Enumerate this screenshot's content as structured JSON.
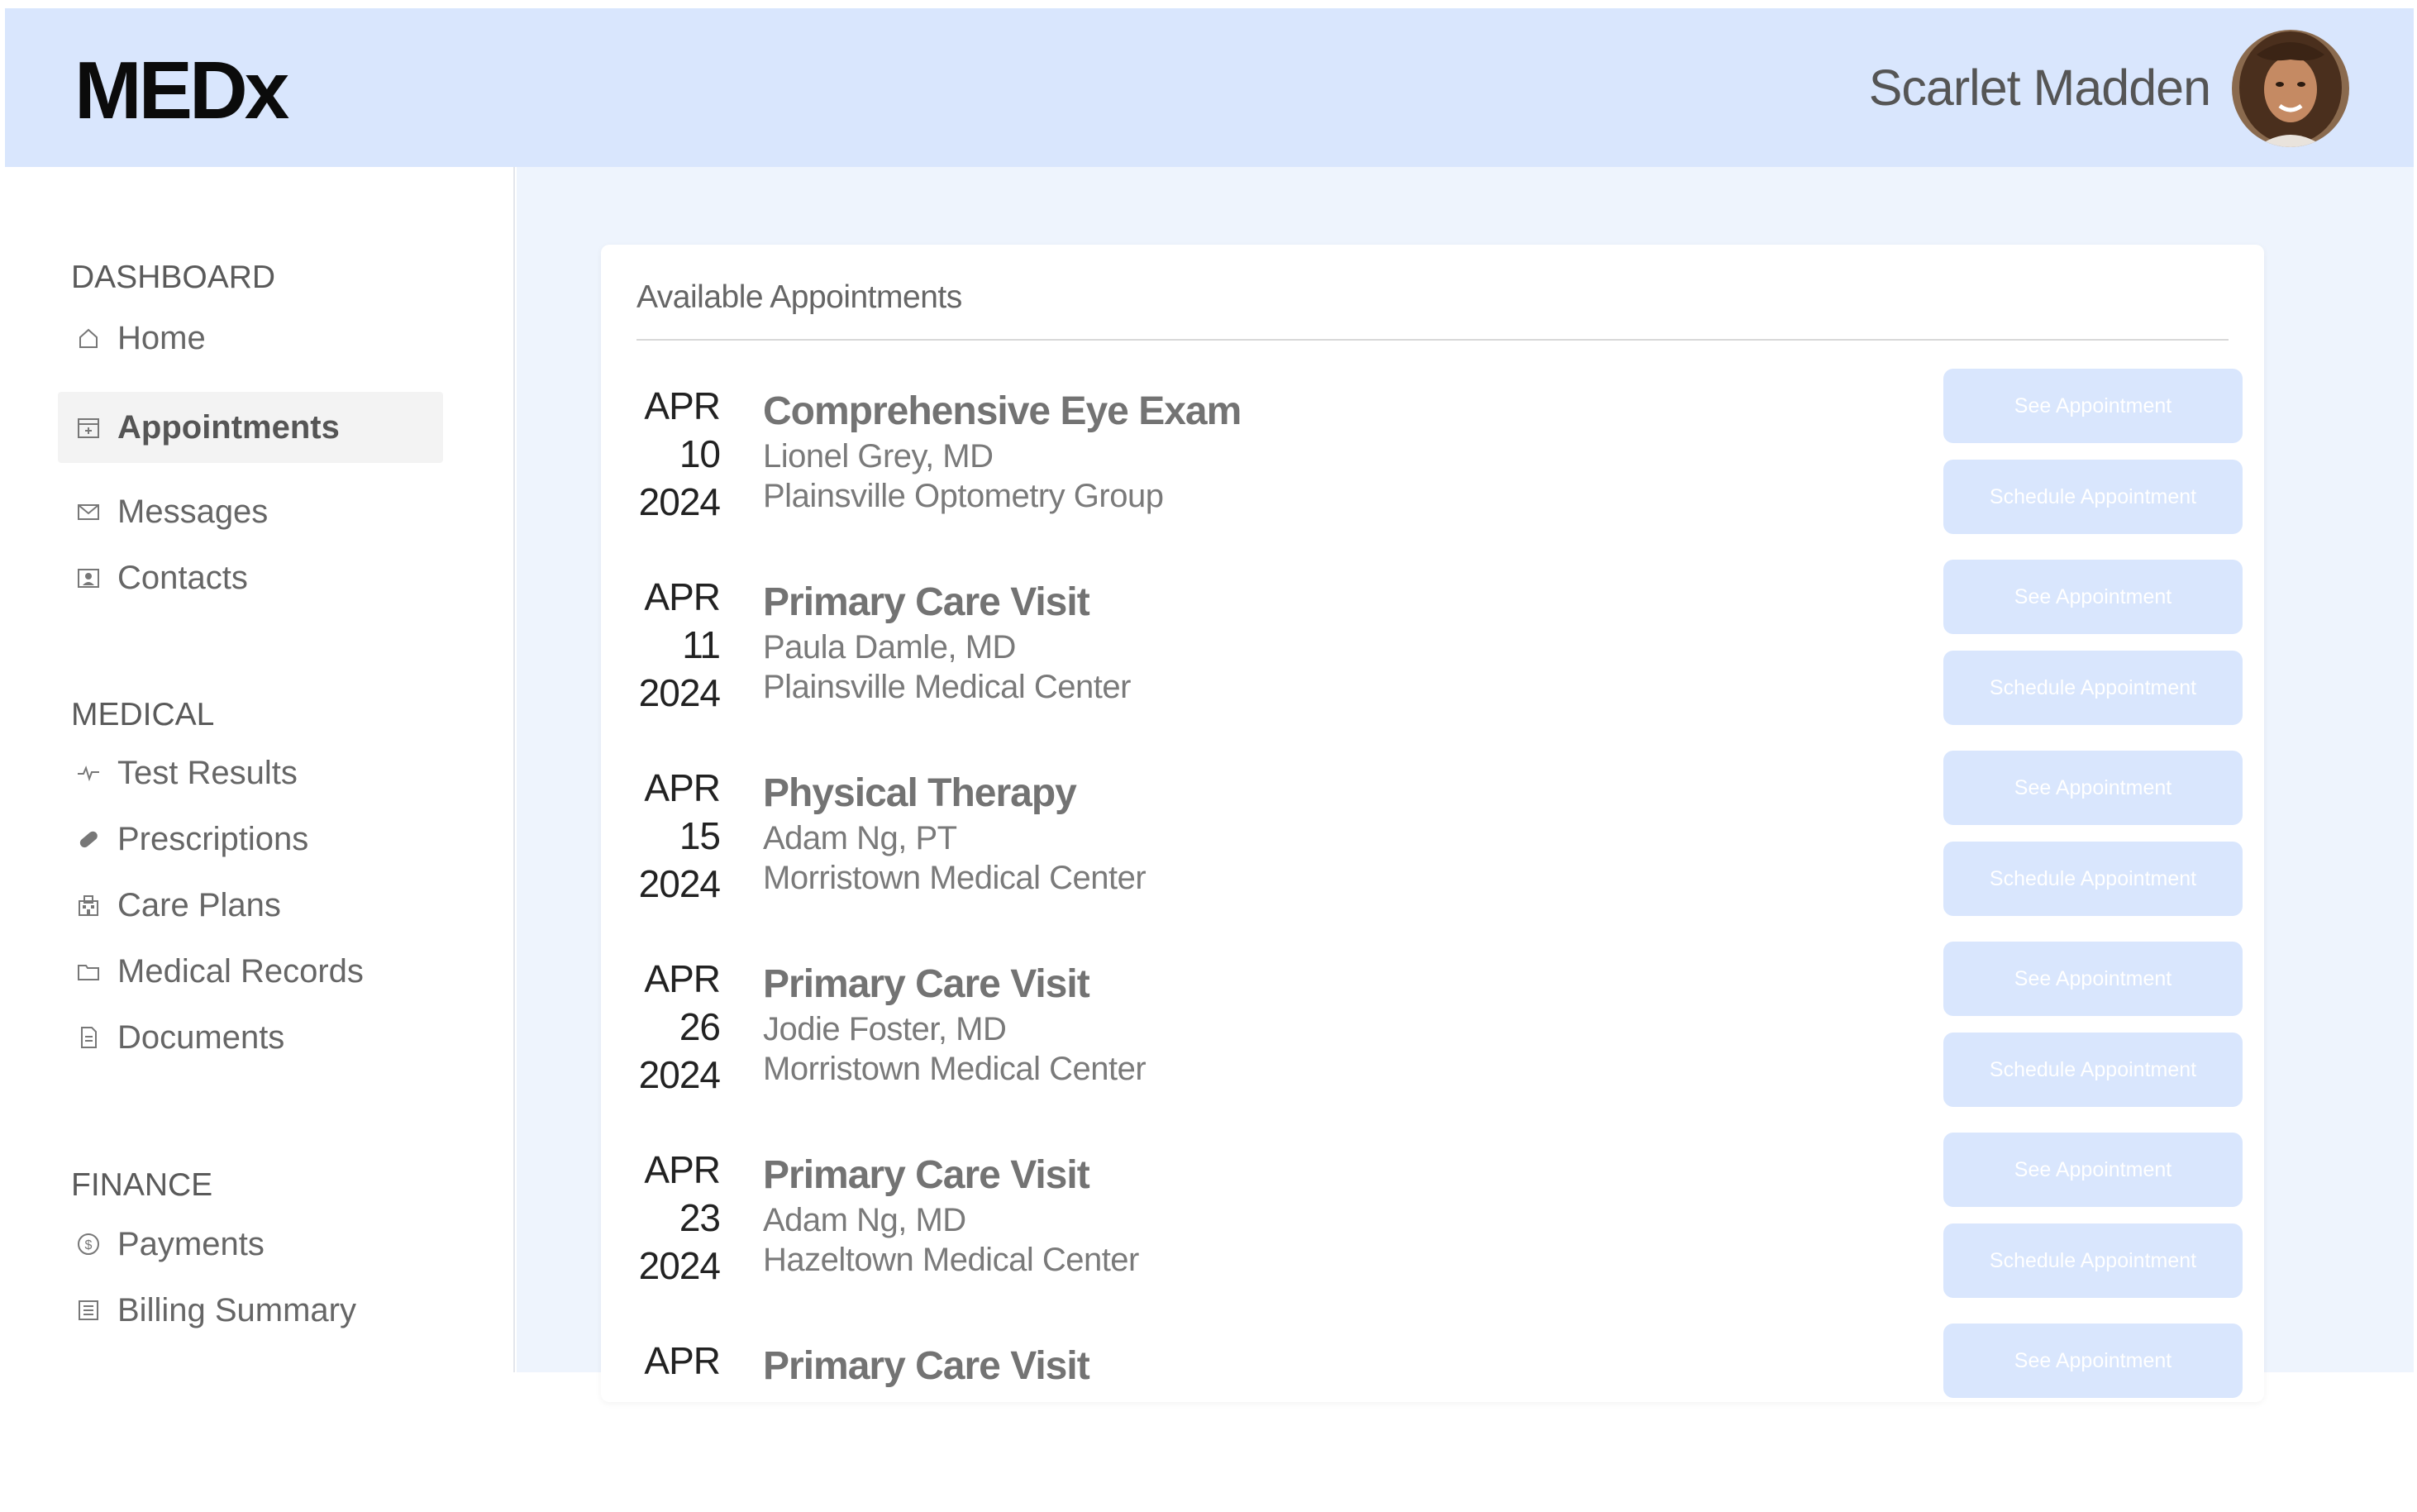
{
  "header": {
    "logo": "MEDx",
    "user_name": "Scarlet Madden",
    "background_color": "#d9e6fd"
  },
  "sidebar": {
    "sections": [
      {
        "title": "DASHBOARD",
        "items": [
          {
            "label": "Home",
            "icon": "home-icon"
          },
          {
            "label": "Appointments",
            "icon": "calendar-icon",
            "active": true
          },
          {
            "label": "Messages",
            "icon": "envelope-icon"
          },
          {
            "label": "Contacts",
            "icon": "contact-card-icon"
          }
        ]
      },
      {
        "title": "MEDICAL",
        "items": [
          {
            "label": "Test Results",
            "icon": "pulse-icon"
          },
          {
            "label": "Prescriptions",
            "icon": "pill-icon"
          },
          {
            "label": "Care Plans",
            "icon": "hospital-icon"
          },
          {
            "label": "Medical Records",
            "icon": "folder-icon"
          },
          {
            "label": "Documents",
            "icon": "document-icon"
          }
        ]
      },
      {
        "title": "FINANCE",
        "items": [
          {
            "label": "Payments",
            "icon": "dollar-coin-icon"
          },
          {
            "label": "Billing Summary",
            "icon": "ledger-icon"
          }
        ]
      }
    ]
  },
  "main": {
    "card_title": "Available Appointments",
    "see_button_label": "See Appointment",
    "schedule_button_label": "Schedule Appointment",
    "appointments": [
      {
        "month": "APR",
        "day": "10",
        "year": "2024",
        "title": "Comprehensive Eye Exam",
        "doctor": "Lionel Grey, MD",
        "location": "Plainsville Optometry Group"
      },
      {
        "month": "APR",
        "day": "11",
        "year": "2024",
        "title": "Primary Care Visit",
        "doctor": "Paula Damle, MD",
        "location": "Plainsville Medical Center"
      },
      {
        "month": "APR",
        "day": "15",
        "year": "2024",
        "title": "Physical Therapy",
        "doctor": "Adam Ng, PT",
        "location": "Morristown Medical Center"
      },
      {
        "month": "APR",
        "day": "26",
        "year": "2024",
        "title": "Primary Care Visit",
        "doctor": "Jodie Foster, MD",
        "location": "Morristown Medical Center"
      },
      {
        "month": "APR",
        "day": "23",
        "year": "2024",
        "title": "Primary Care Visit",
        "doctor": "Adam Ng, MD",
        "location": "Hazeltown Medical Center"
      },
      {
        "month": "APR",
        "day": "",
        "year": "",
        "title": "Primary Care Visit",
        "doctor": "",
        "location": ""
      }
    ]
  },
  "colors": {
    "accent": "#d9e6fd",
    "main_background": "#eef4fd"
  }
}
